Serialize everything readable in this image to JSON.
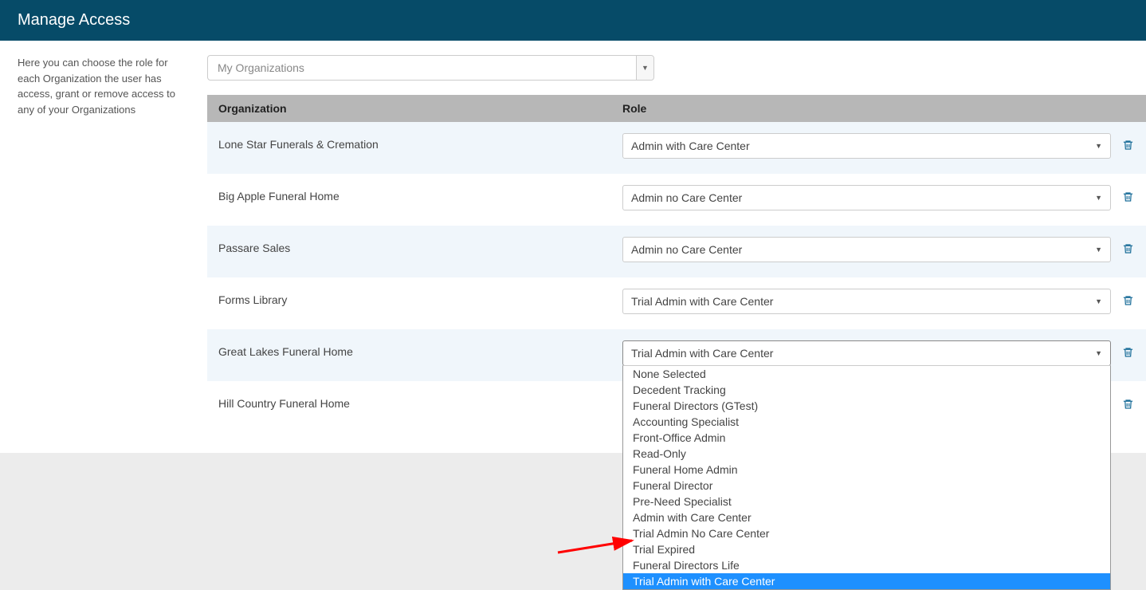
{
  "header": {
    "title": "Manage Access"
  },
  "sidebar": {
    "description": "Here you can choose the role for each Organization the user has access, grant or remove access to any of your Organizations"
  },
  "org_select": {
    "placeholder": "My Organizations"
  },
  "table": {
    "headers": {
      "organization": "Organization",
      "role": "Role"
    },
    "rows": [
      {
        "org": "Lone Star Funerals & Cremation",
        "role": "Admin with Care Center"
      },
      {
        "org": "Big Apple Funeral Home",
        "role": "Admin no Care Center"
      },
      {
        "org": "Passare Sales",
        "role": "Admin no Care Center"
      },
      {
        "org": "Forms Library",
        "role": "Trial Admin with Care Center"
      },
      {
        "org": "Great Lakes Funeral Home",
        "role": "Trial Admin with Care Center",
        "open": true
      },
      {
        "org": "Hill Country Funeral Home",
        "role": ""
      }
    ]
  },
  "role_options": [
    "None Selected",
    "Decedent Tracking",
    "Funeral Directors (GTest)",
    "Accounting Specialist",
    "Front-Office Admin",
    "Read-Only",
    "Funeral Home Admin",
    "Funeral Director",
    "Pre-Need Specialist",
    "Admin with Care Center",
    "Trial Admin No Care Center",
    "Trial Expired",
    "Funeral Directors Life",
    "Trial Admin with Care Center"
  ],
  "dropdown_selected": "Trial Admin with Care Center"
}
